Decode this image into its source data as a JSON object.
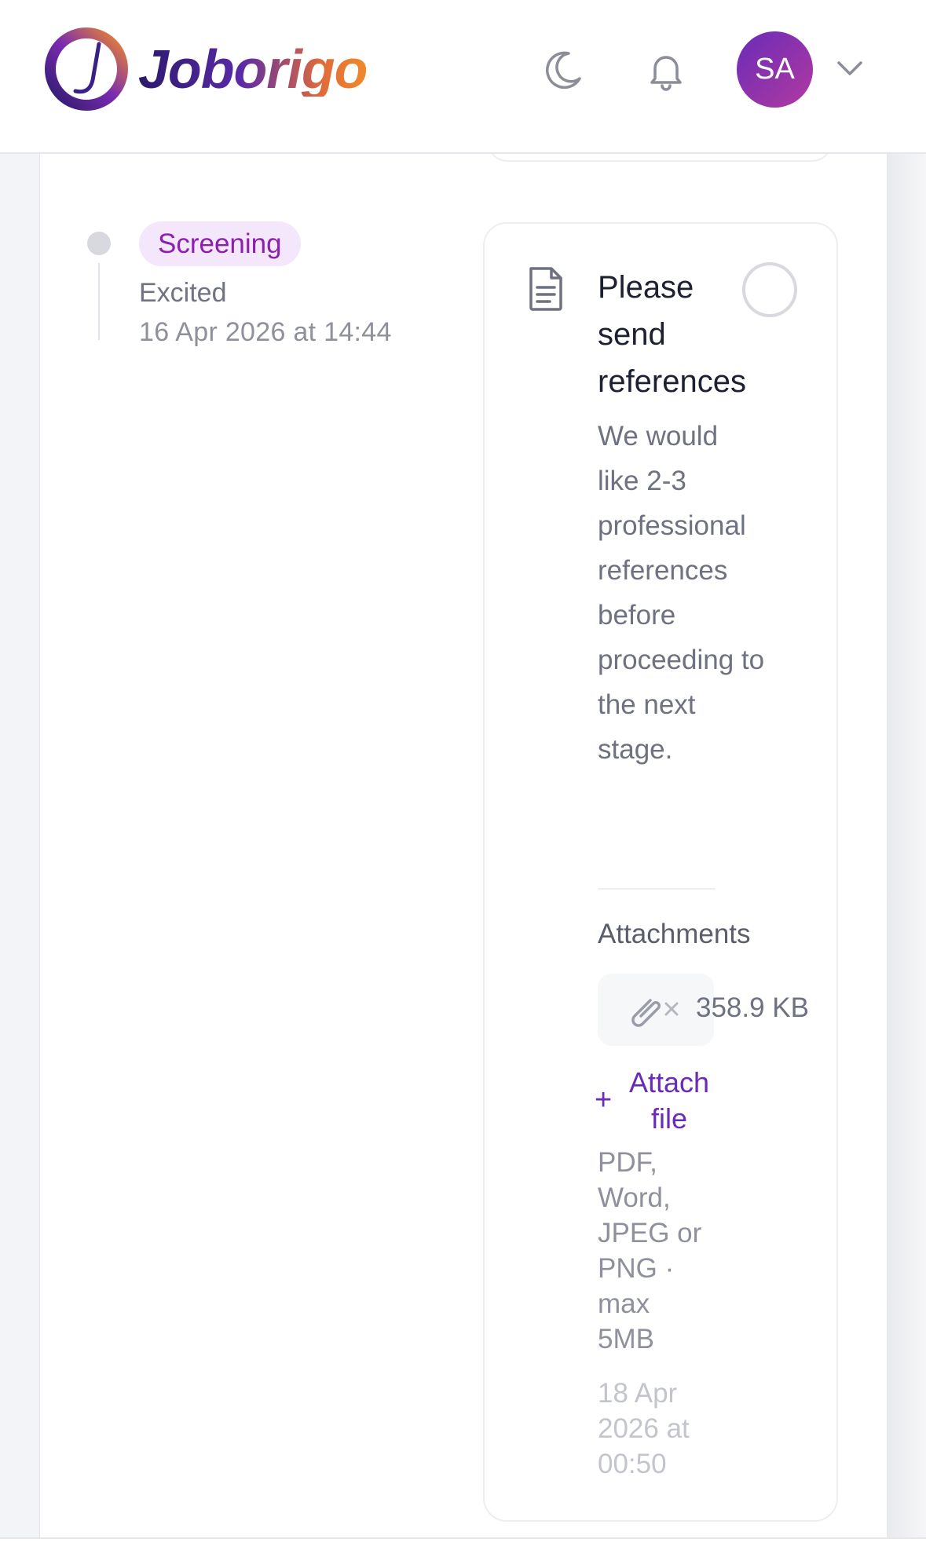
{
  "header": {
    "brand": "Joborigo",
    "user_initials": "SA"
  },
  "icons": {
    "theme": "moon-icon",
    "notifications": "bell-icon",
    "menu": "chevron-down-icon",
    "document": "document-icon",
    "attachment": "paperclip-icon"
  },
  "colors": {
    "accent": "#6a2bb8",
    "badge_bg": "#f4e7fb",
    "badge_text": "#8d1fb0"
  },
  "timeline": {
    "stage": "Screening",
    "mood": "Excited",
    "date": "16 Apr 2026 at 14:44"
  },
  "task": {
    "title": "Please send references",
    "description": "We would like 2-3 professional references before proceeding to the next stage.",
    "attachments_label": "Attachments",
    "attachment_size": "358.9 KB",
    "attach_action": "Attach file",
    "file_hint": "PDF, Word, JPEG or PNG · max 5MB",
    "date": "18 Apr 2026 at 00:50"
  }
}
